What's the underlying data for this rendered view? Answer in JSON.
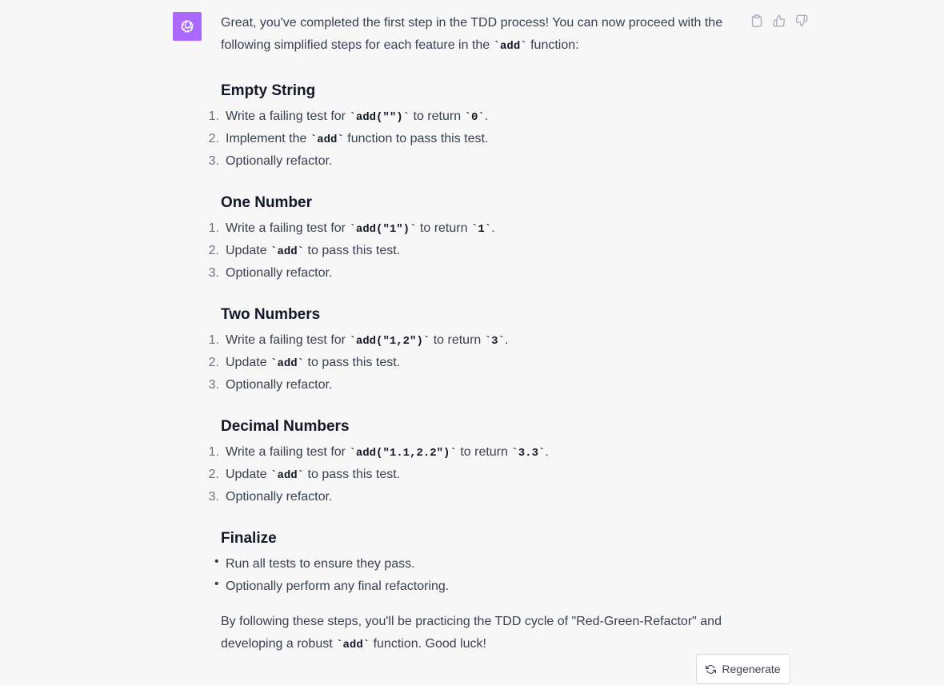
{
  "intro": {
    "text_before": "Great, you've completed the first step in the TDD process! You can now proceed with the following simplified steps for each feature in the ",
    "code": "add",
    "text_after": " function:"
  },
  "sections": [
    {
      "heading": "Empty String",
      "items": [
        {
          "num": "1.",
          "a": "Write a failing test for ",
          "code1": "add(\"\")",
          "b": " to return ",
          "code2": "0",
          "c": "."
        },
        {
          "num": "2.",
          "a": "Implement the ",
          "code1": "add",
          "b": " function to pass this test."
        },
        {
          "num": "3.",
          "a": "Optionally refactor."
        }
      ]
    },
    {
      "heading": "One Number",
      "items": [
        {
          "num": "1.",
          "a": "Write a failing test for ",
          "code1": "add(\"1\")",
          "b": " to return ",
          "code2": "1",
          "c": "."
        },
        {
          "num": "2.",
          "a": "Update ",
          "code1": "add",
          "b": " to pass this test."
        },
        {
          "num": "3.",
          "a": "Optionally refactor."
        }
      ]
    },
    {
      "heading": "Two Numbers",
      "items": [
        {
          "num": "1.",
          "a": "Write a failing test for ",
          "code1": "add(\"1,2\")",
          "b": " to return ",
          "code2": "3",
          "c": "."
        },
        {
          "num": "2.",
          "a": "Update ",
          "code1": "add",
          "b": " to pass this test."
        },
        {
          "num": "3.",
          "a": "Optionally refactor."
        }
      ]
    },
    {
      "heading": "Decimal Numbers",
      "items": [
        {
          "num": "1.",
          "a": "Write a failing test for ",
          "code1": "add(\"1.1,2.2\")",
          "b": " to return ",
          "code2": "3.3",
          "c": "."
        },
        {
          "num": "2.",
          "a": "Update ",
          "code1": "add",
          "b": " to pass this test."
        },
        {
          "num": "3.",
          "a": "Optionally refactor."
        }
      ]
    }
  ],
  "finalize": {
    "heading": "Finalize",
    "bullets": [
      "Run all tests to ensure they pass.",
      "Optionally perform any final refactoring."
    ]
  },
  "outro": {
    "text_before": "By following these steps, you'll be practicing the TDD cycle of \"Red-Green-Refactor\" and developing a robust ",
    "code": "add",
    "text_after": " function. Good luck!"
  },
  "regenerate_label": "Regenerate",
  "icons": {
    "avatar": "openai-logo-icon",
    "copy": "clipboard-icon",
    "like": "thumbs-up-icon",
    "dislike": "thumbs-down-icon",
    "regenerate": "refresh-icon"
  },
  "colors": {
    "avatar_bg": "#ab68ff",
    "page_bg": "#f7f7f8",
    "text": "#374151"
  }
}
